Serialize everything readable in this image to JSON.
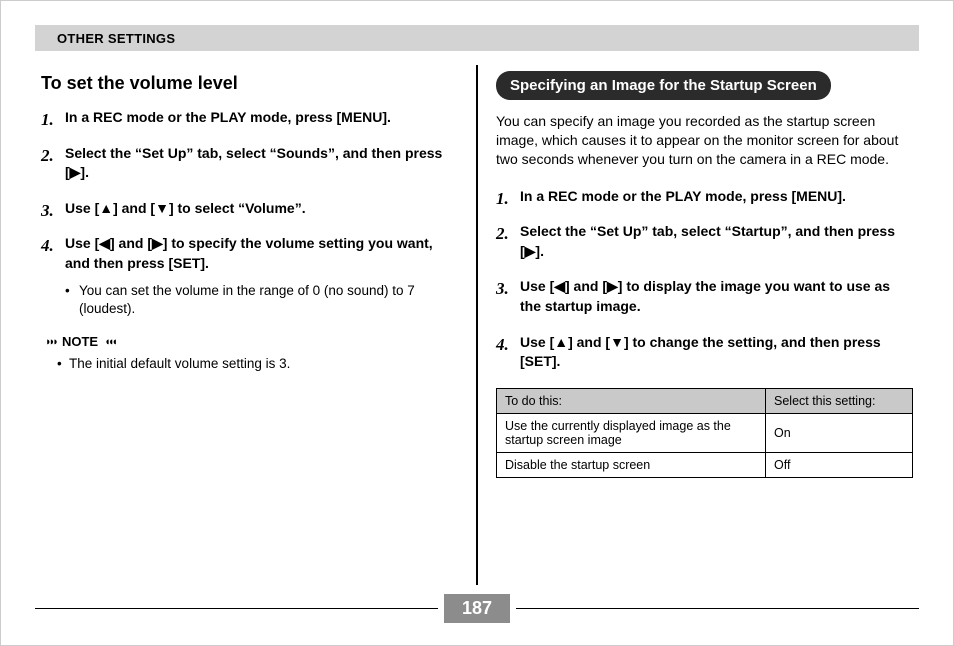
{
  "header": "OTHER SETTINGS",
  "left": {
    "title": "To set the volume level",
    "steps": [
      "In a REC mode or the PLAY mode, press [MENU].",
      "Select the “Set Up” tab, select “Sounds”, and then press [▶].",
      "Use [▲] and [▼] to select “Volume”.",
      "Use [◀] and [▶] to specify the volume setting you want, and then press [SET]."
    ],
    "step4_sub": "You can set the volume in the range of 0 (no sound) to 7 (loudest).",
    "note_label": "NOTE",
    "note_text": "The initial default volume setting is 3."
  },
  "right": {
    "pill": "Specifying an Image for the Startup Screen",
    "intro": "You can specify an image you recorded as the startup screen image, which causes it to appear on the monitor screen for about two seconds whenever you turn on the camera in a REC mode.",
    "steps": [
      "In a REC mode or the PLAY mode, press [MENU].",
      "Select the “Set Up” tab, select “Startup”, and then press [▶].",
      "Use [◀] and [▶] to display the image you want to use as the startup image.",
      "Use [▲] and [▼] to change the setting, and then press [SET]."
    ],
    "table": {
      "head": [
        "To do this:",
        "Select this setting:"
      ],
      "rows": [
        [
          "Use the currently displayed image as the startup screen image",
          "On"
        ],
        [
          "Disable the startup screen",
          "Off"
        ]
      ]
    }
  },
  "page_number": "187"
}
